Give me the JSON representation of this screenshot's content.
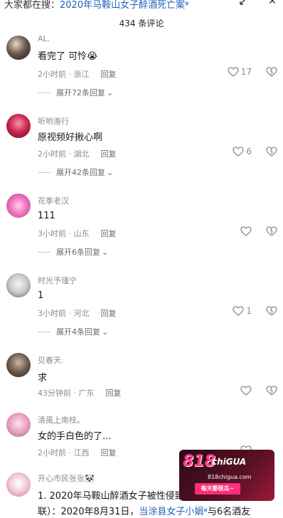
{
  "top_bar": {
    "search_prefix": "大家都在搜：",
    "search_query": "2020年马鞍山女子醉酒死亡案",
    "expand_icon": "expand-icon",
    "close_label": "✕"
  },
  "comment_count": "434 条评论",
  "comments": [
    {
      "username": "AL.",
      "text": "看完了 可怜😭",
      "time_location": "2小时前 · 浙江",
      "reply_label": "回复",
      "likes": "17",
      "expand_label": "展开72条回复"
    },
    {
      "username": "听哟渔行",
      "text": "原视频好揪心啊",
      "time_location": "2小时前 · 湖北",
      "reply_label": "回复",
      "likes": "6",
      "expand_label": "展开42条回复"
    },
    {
      "username": "花季老汉",
      "text": "111",
      "time_location": "3小时前 · 山东",
      "reply_label": "回复",
      "likes": "",
      "expand_label": "展开6条回复"
    },
    {
      "username": "时光予瑾宁",
      "text": "1",
      "time_location": "3小时前 · 河北",
      "reply_label": "回复",
      "likes": "1",
      "expand_label": "展开4条回复"
    },
    {
      "username": "见春天.",
      "text": "求",
      "time_location": "43分钟前 · 广东",
      "reply_label": "回复",
      "likes": "",
      "expand_label": ""
    },
    {
      "username": "清風上南枝。",
      "text": "女的手白色的了...",
      "time_location": "2小时前 · 江西",
      "reply_label": "回复",
      "likes": "",
      "expand_label": ""
    }
  ],
  "last_comment": {
    "username": "开心市民张张🐼",
    "line1": "1. 2020年马鞍山醉酒女子被性侵致死案（核心实",
    "line2_prefix": "联）：2020年8月31日，",
    "line2_link": "当涂县女子小娟",
    "line2_suffix": "与6名酒友"
  },
  "promo": {
    "brand": "818",
    "brand2": "chiGUA",
    "site": "818chigua.com",
    "slogan": "每天都很瓜~"
  }
}
